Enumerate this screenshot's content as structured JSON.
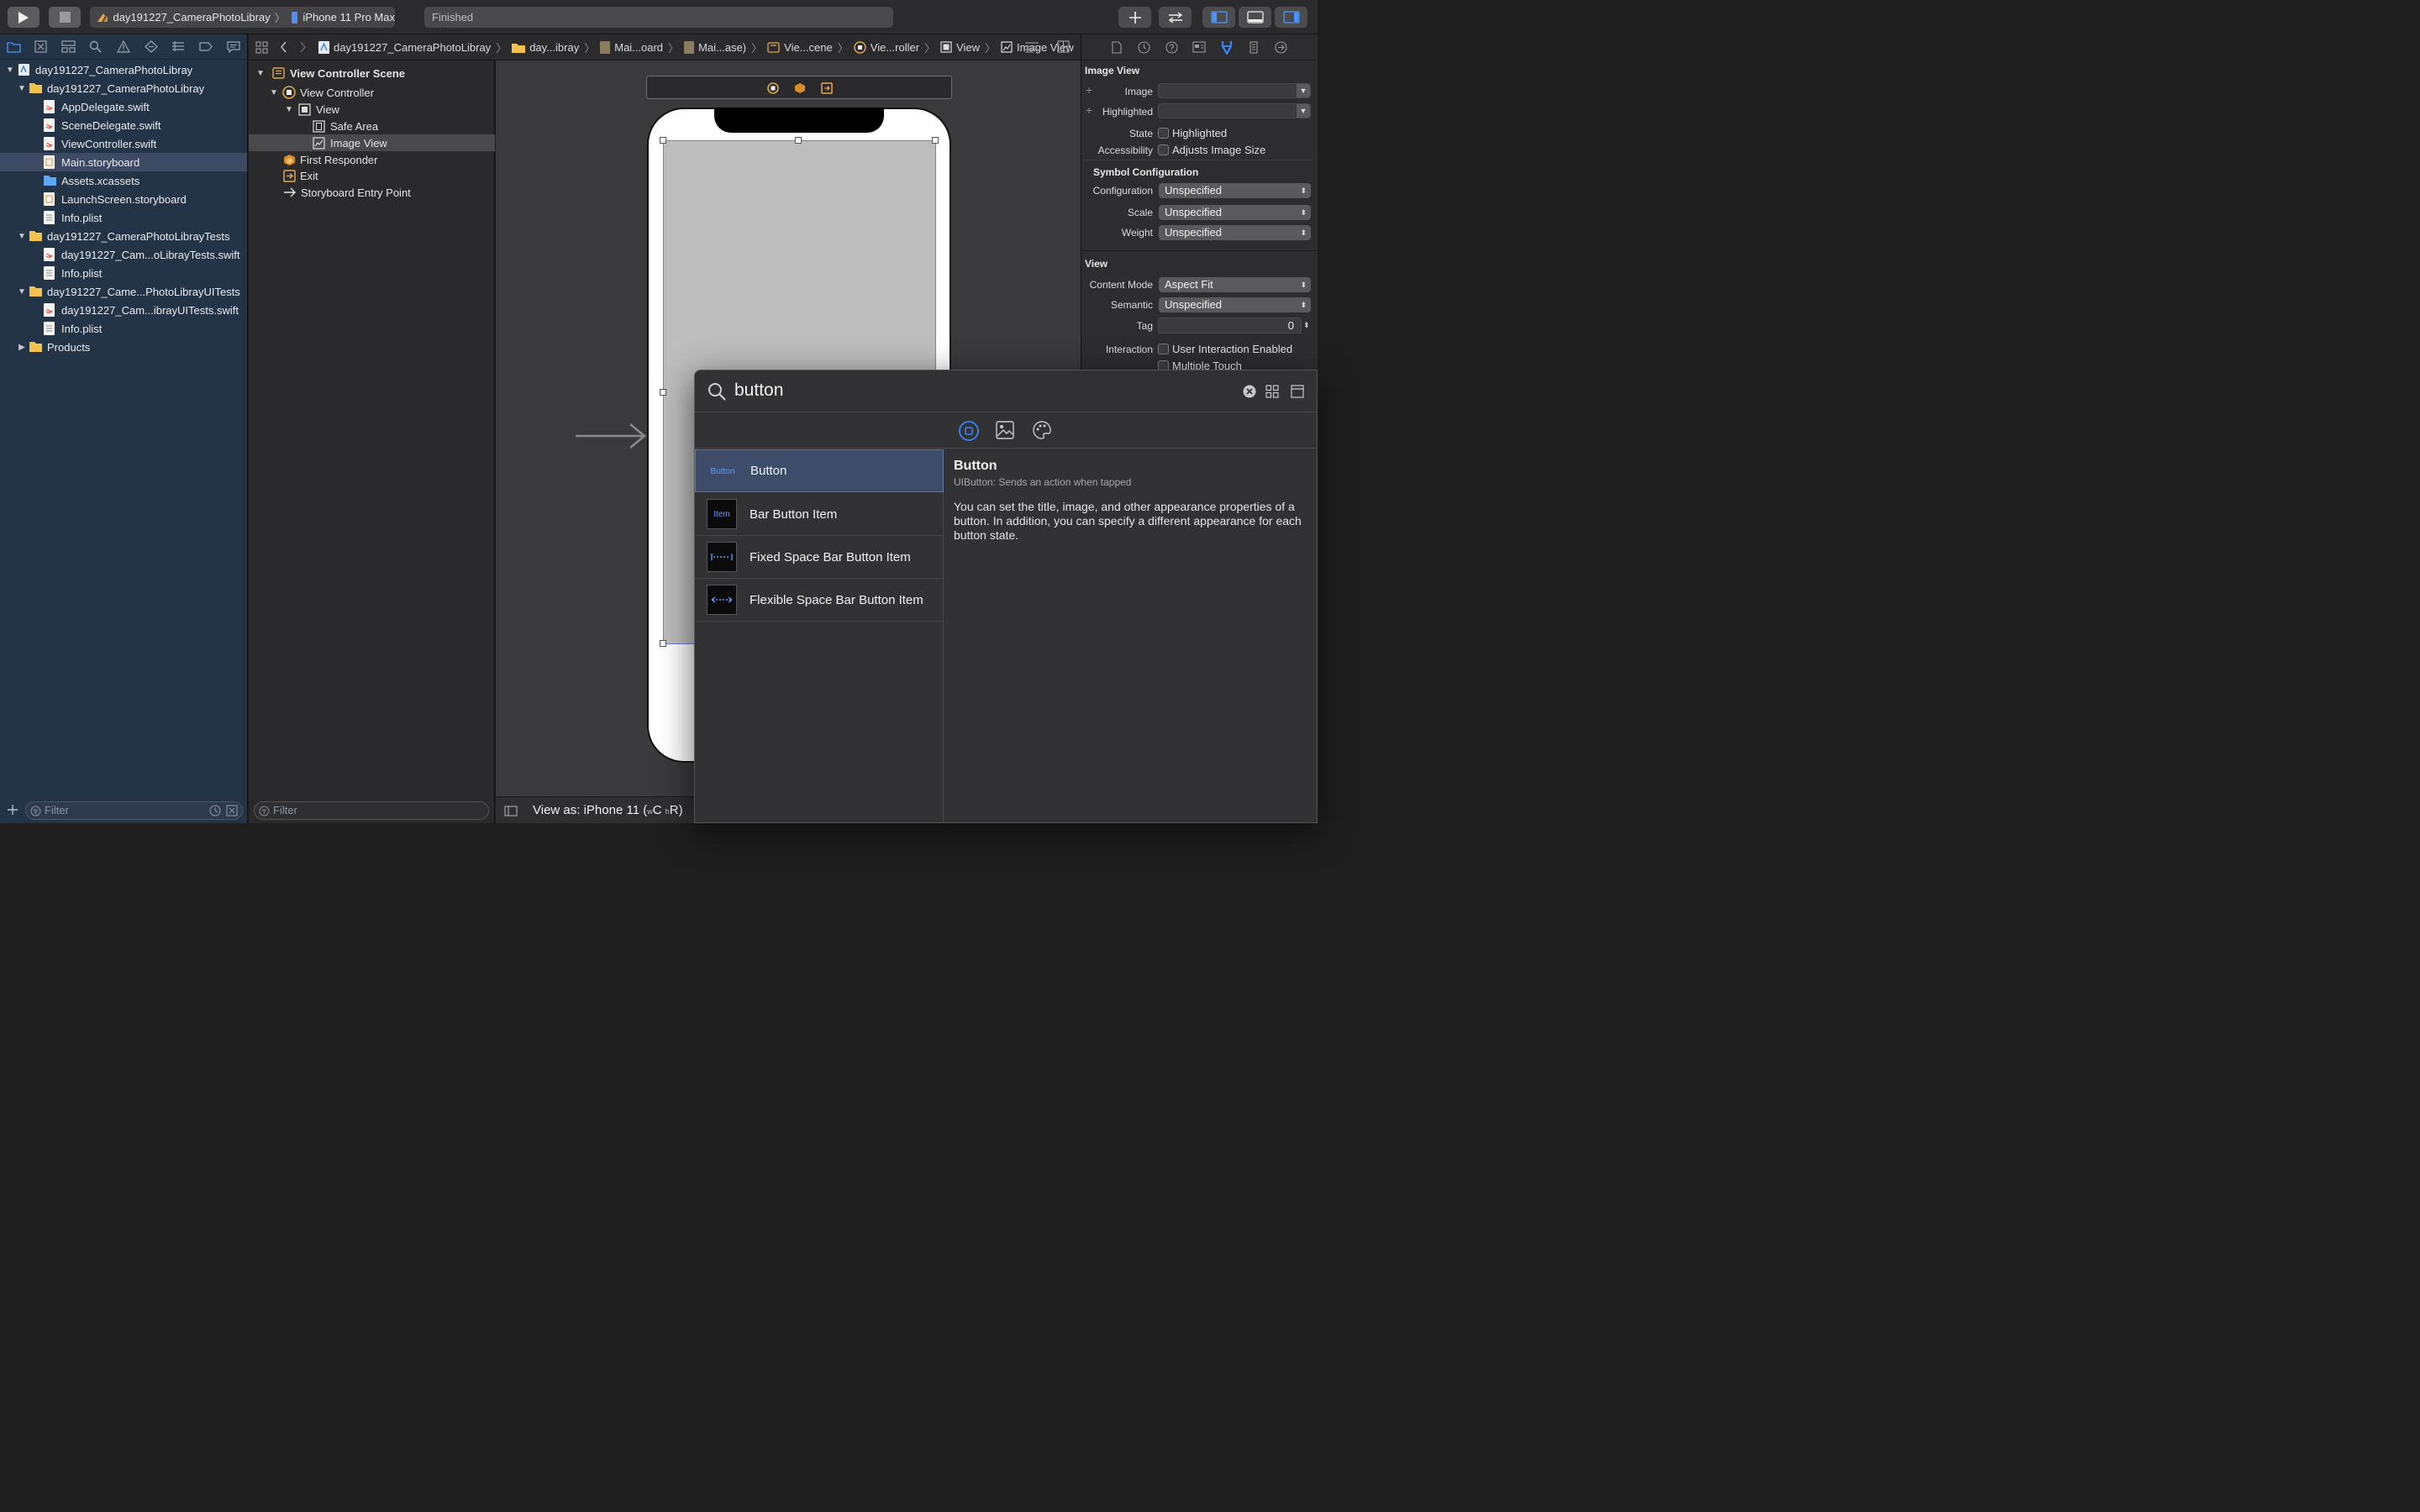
{
  "toolbar": {
    "scheme_project": "day191227_CameraPhotoLibray",
    "scheme_device": "iPhone 11 Pro Max",
    "activity_status": "Finished",
    "colors": {
      "accent": "#3a82f7",
      "background": "#2b2b2d"
    }
  },
  "navigator": {
    "items": [
      {
        "label": "day191227_CameraPhotoLibray"
      },
      {
        "label": "day191227_CameraPhotoLibray"
      },
      {
        "label": "AppDelegate.swift"
      },
      {
        "label": "SceneDelegate.swift"
      },
      {
        "label": "ViewController.swift"
      },
      {
        "label": "Main.storyboard"
      },
      {
        "label": "Assets.xcassets"
      },
      {
        "label": "LaunchScreen.storyboard"
      },
      {
        "label": "Info.plist"
      },
      {
        "label": "day191227_CameraPhotoLibrayTests"
      },
      {
        "label": "day191227_Cam...oLibrayTests.swift"
      },
      {
        "label": "Info.plist"
      },
      {
        "label": "day191227_Came...PhotoLibrayUITests"
      },
      {
        "label": "day191227_Cam...ibrayUITests.swift"
      },
      {
        "label": "Info.plist"
      },
      {
        "label": "Products"
      }
    ],
    "filter_placeholder": "Filter"
  },
  "outline": {
    "items": [
      {
        "label": "View Controller Scene"
      },
      {
        "label": "View Controller"
      },
      {
        "label": "View"
      },
      {
        "label": "Safe Area"
      },
      {
        "label": "Image View"
      },
      {
        "label": "First Responder"
      },
      {
        "label": "Exit"
      },
      {
        "label": "Storyboard Entry Point"
      }
    ],
    "filter_placeholder": "Filter"
  },
  "jumpbar": {
    "crumbs": [
      {
        "label": "day191227_CameraPhotoLibray"
      },
      {
        "label": "day...ibray"
      },
      {
        "label": "Mai...oard"
      },
      {
        "label": "Mai...ase)"
      },
      {
        "label": "Vie...cene"
      },
      {
        "label": "Vie...roller"
      },
      {
        "label": "View"
      },
      {
        "label": "Image View"
      }
    ]
  },
  "canvas": {
    "view_as": "View as: iPhone 11 (",
    "size_w": "w",
    "size_c": "C",
    "size_h": "h",
    "size_r": "R)"
  },
  "inspector": {
    "image_view_title": "Image View",
    "image_label": "Image",
    "highlighted_label": "Highlighted",
    "state_label": "State",
    "state_value": "Highlighted",
    "accessibility_label": "Accessibility",
    "accessibility_value": "Adjusts Image Size",
    "symbol_config_title": "Symbol Configuration",
    "configuration_label": "Configuration",
    "configuration_value": "Unspecified",
    "scale_label": "Scale",
    "scale_value": "Unspecified",
    "weight_label": "Weight",
    "weight_value": "Unspecified",
    "view_title": "View",
    "content_mode_label": "Content Mode",
    "content_mode_value": "Aspect Fit",
    "semantic_label": "Semantic",
    "semantic_value": "Unspecified",
    "tag_label": "Tag",
    "tag_value": "0",
    "interaction_label": "Interaction",
    "interaction_value": "User Interaction Enabled",
    "multiple_touch": "Multiple Touch"
  },
  "library": {
    "search_value": "button",
    "items": [
      {
        "name": "Button",
        "thumb": "Button"
      },
      {
        "name": "Bar Button Item",
        "thumb": "Item"
      },
      {
        "name": "Fixed Space Bar Button Item",
        "thumb": ""
      },
      {
        "name": "Flexible Space Bar Button Item",
        "thumb": ""
      }
    ],
    "detail_title": "Button",
    "detail_subtitle": "UIButton: Sends an action when tapped",
    "detail_body": "You can set the title, image, and other appearance properties of a button. In addition, you can specify a different appearance for each button state."
  }
}
